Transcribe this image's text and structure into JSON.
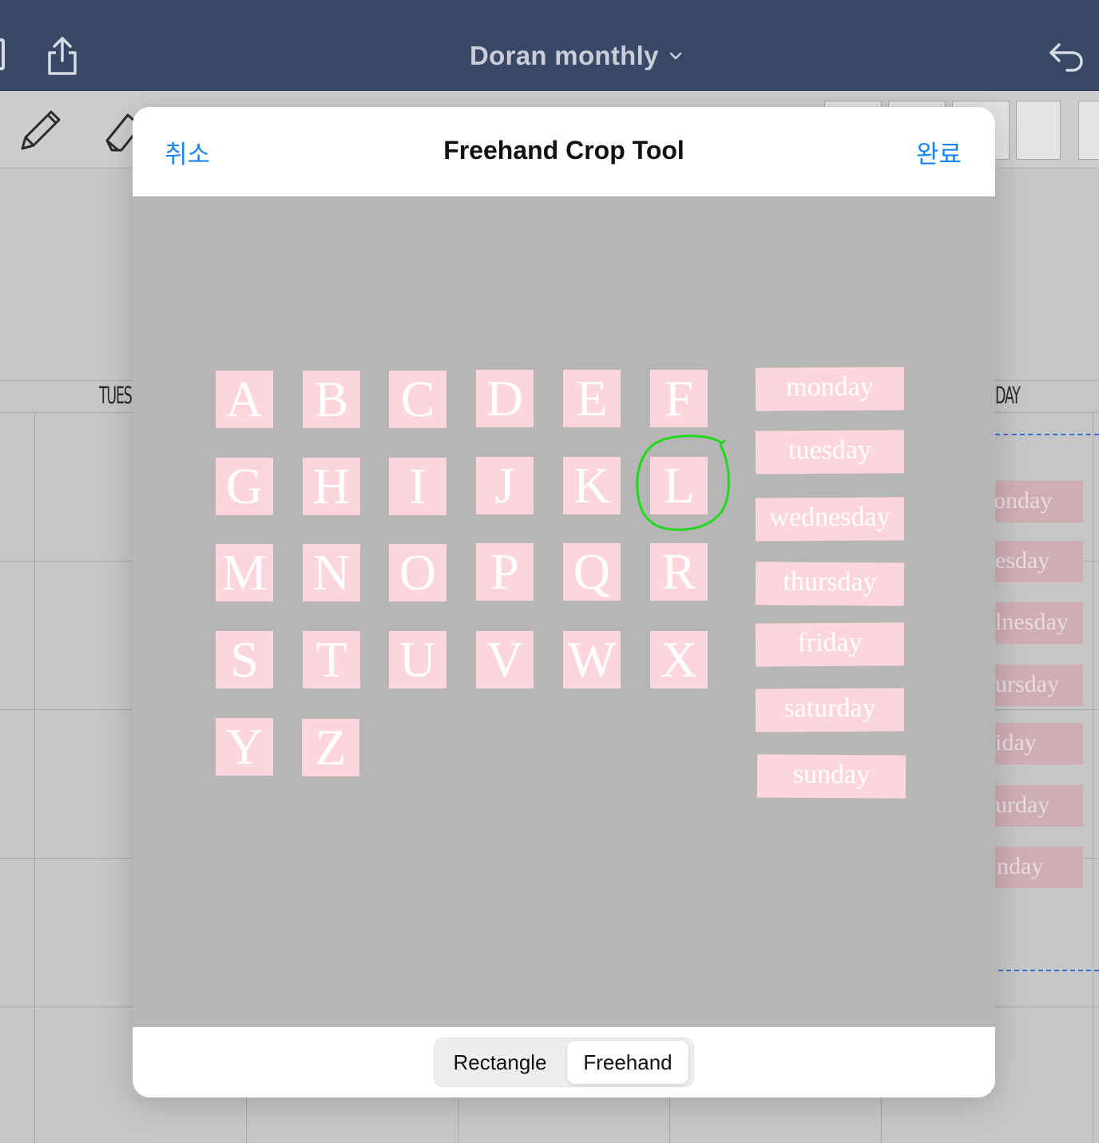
{
  "topbar": {
    "title": "Doran monthly",
    "bg_color": "#384866"
  },
  "background": {
    "day_left": "TUES",
    "day_right": "DAY",
    "chips": [
      "onday",
      "esday",
      "lnesday",
      "ursday",
      "iday",
      "urday",
      "nday"
    ]
  },
  "modal": {
    "cancel_label": "취소",
    "title": "Freehand Crop Tool",
    "done_label": "완료",
    "accent_color": "#1a84f0",
    "sticker_color": "#fdd6dd",
    "selection_color": "#22d81a",
    "letters": [
      "A",
      "B",
      "C",
      "D",
      "E",
      "F",
      "G",
      "H",
      "I",
      "J",
      "K",
      "L",
      "M",
      "N",
      "O",
      "P",
      "Q",
      "R",
      "S",
      "T",
      "U",
      "V",
      "W",
      "X",
      "Y",
      "Z"
    ],
    "selected_letter": "L",
    "words": [
      "monday",
      "tuesday",
      "wednesday",
      "thursday",
      "friday",
      "saturday",
      "sunday"
    ],
    "modes": {
      "rectangle": "Rectangle",
      "freehand": "Freehand",
      "selected": "Freehand"
    }
  }
}
